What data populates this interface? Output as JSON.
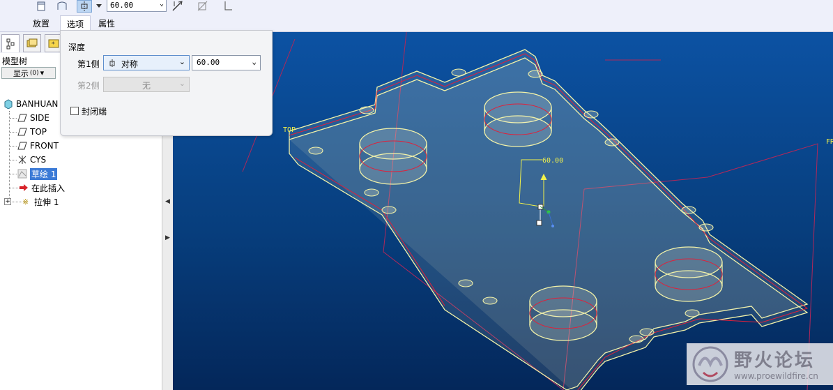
{
  "dashboard": {
    "depth_value": "60.00",
    "tabs": [
      {
        "label": "放置"
      },
      {
        "label": "选项"
      },
      {
        "label": "属性"
      }
    ]
  },
  "model_tree": {
    "title": "模型树",
    "show_label": "显示",
    "show_count": "(0)",
    "items": [
      {
        "label": "BANHUAN",
        "icon": "part-icon"
      },
      {
        "label": "SIDE",
        "icon": "datum-plane-icon"
      },
      {
        "label": "TOP",
        "icon": "datum-plane-icon"
      },
      {
        "label": "FRONT",
        "icon": "datum-plane-icon"
      },
      {
        "label": "CYS",
        "icon": "coordinate-system-icon"
      },
      {
        "label": "草绘 1",
        "icon": "sketch-icon"
      },
      {
        "label": "在此插入",
        "icon": "insert-arrow-icon"
      },
      {
        "label": "拉伸 1",
        "icon": "extrude-icon"
      }
    ]
  },
  "options": {
    "depth_heading": "深度",
    "side1_label": "第1侧",
    "side1_type": "对称",
    "side1_depth": "60.00",
    "side2_label": "第2侧",
    "side2_type": "无",
    "capped_label": "封闭端",
    "capped_checked": false
  },
  "viewport": {
    "datum_top_label": "TOP",
    "datum_front_label": "FR",
    "dimension_label": "60.00"
  },
  "colors": {
    "viewport_top": "#0c52a3",
    "viewport_bottom": "#04275a",
    "edge_yellow": "#f2f2a8",
    "section_red": "#e0203a",
    "datum_magenta": "#b0285a"
  },
  "watermark": {
    "title": "野火论坛",
    "url": "www.proewildfire.cn"
  }
}
